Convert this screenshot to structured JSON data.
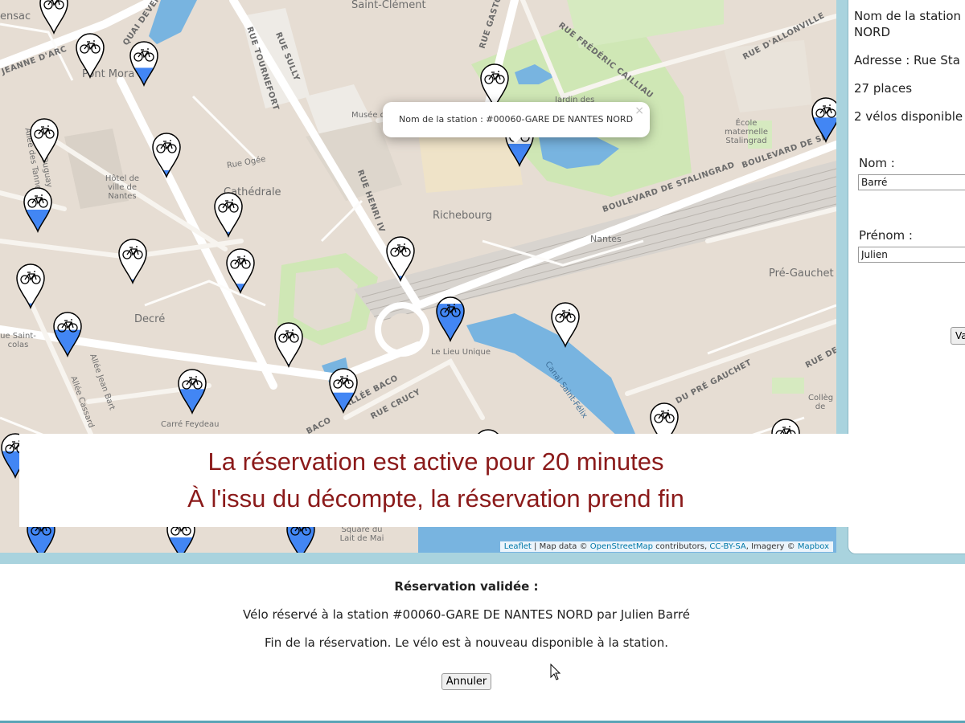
{
  "map": {
    "places": {
      "saint_clement": "Saint-Clément",
      "pont_morand": "Pont Mora",
      "cathedrale": "Cathédrale",
      "richebourg": "Richebourg",
      "nantes": "Nantes",
      "pre_gauchet": "Pré-Gauchet",
      "decre": "Decré",
      "le_lieu_unique": "Le Lieu Unique",
      "carre_feydeau": "Carré Feydeau",
      "square": "Square du Lait de Mai",
      "sac": "ensac",
      "hotel_de_ville": "Hôtel de ville de Nantes",
      "musee": "Musée des",
      "jardin": "Jardin des",
      "ecole": "École maternelle Stalingrad",
      "rue_saint": "ue Saint- colas",
      "college": "Collèg de",
      "rue_ogee": "Rue Ogée"
    },
    "streets": {
      "rue_tournefort": "RUE TOURNEFORT",
      "rue_sully": "RUE SULLY",
      "rue_henri": "RUE HENRI IV",
      "rue_gaston": "RUE GASTO",
      "rue_frederic": "RUE FRÉDÉRIC CAILLIAU",
      "rue_allonville": "RUE D'ALLONVILLE",
      "boulevard_stalingrad": "BOULEVARD DE STALINGRAD",
      "boulevard_se": "BOULEVARD DE SE",
      "quai": "QUAI DEVER",
      "jeanne": "JEANNE D'ARC",
      "allee_baco": "ALLÉE BACO",
      "rue_crucy": "RUE CRUCY",
      "gauchet": "DU PRÉ GAUCHET",
      "rue_gauchet": "RUE DE",
      "canal": "Canal Saint-Félix",
      "baco": "BACO",
      "allee_tanneurs": "Allée des Tanneurs",
      "allee_jean_bart": "Allée Jean Bart",
      "allee_cassard": "Allée Cassard",
      "allee_duguay": "Allée Duguay"
    },
    "popup": {
      "text": "Nom de la station : #00060-GARE DE NANTES NORD",
      "close": "×"
    },
    "attribution": {
      "leaflet": "Leaflet",
      "sep1": " | Map data © ",
      "osm": "OpenStreetMap",
      "contrib": " contributors, ",
      "license": "CC-BY-SA",
      "imagery": ", Imagery © ",
      "mapbox": "Mapbox"
    },
    "colors": {
      "marker_fill": "#4286f4",
      "marker_border": "#000000",
      "water": "#78b4e0",
      "park": "#cfe7b5"
    }
  },
  "caption": {
    "line1": "La réservation est active pour 20 minutes",
    "line2": "À l'issu du décompte, la réservation prend fin"
  },
  "side_panel": {
    "station_name_prefix": "Nom de la station",
    "station_name": "NORD",
    "address": "Adresse : Rue Sta",
    "places": "27 places",
    "bikes": "2 vélos disponible",
    "nom_label": "Nom :",
    "nom_value": "Barré",
    "prenom_label": "Prénom :",
    "prenom_value": "Julien",
    "validate": "Va"
  },
  "reservation": {
    "title": "Réservation validée :",
    "detail": "Vélo réservé à la station #00060-GARE DE NANTES NORD par Julien Barré",
    "end": "Fin de la réservation. Le vélo est à nouveau disponible à la station.",
    "cancel": "Annuler"
  }
}
